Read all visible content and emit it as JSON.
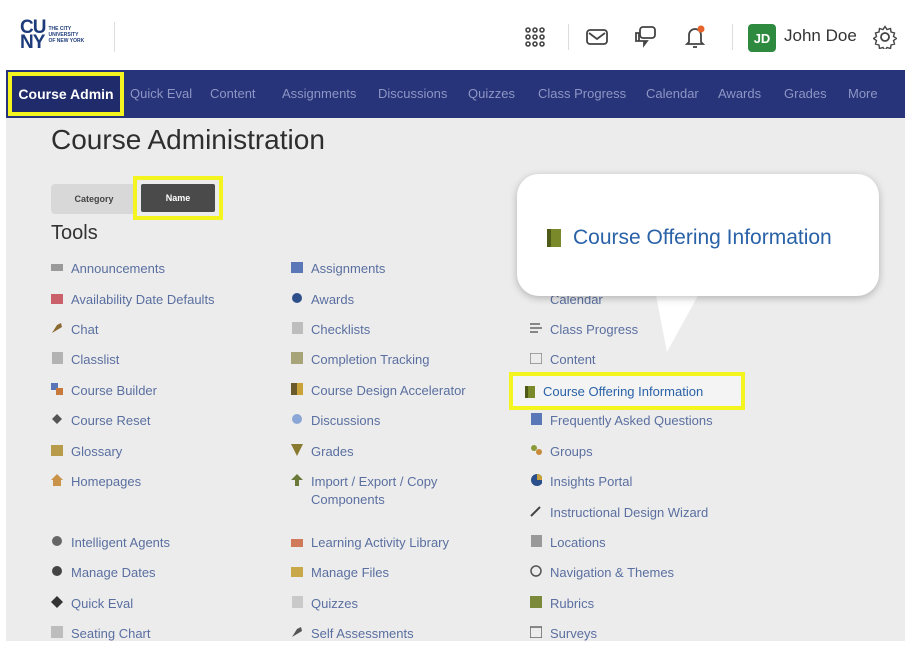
{
  "header": {
    "logo_mark": "CU\nNY",
    "logo_text": "THE CITY UNIVERSITY OF NEW YORK",
    "user_initials": "JD",
    "user_name": "John Doe"
  },
  "navbar": {
    "active": "Course Admin",
    "items": [
      "Quick Eval",
      "Content",
      "Assignments",
      "Discussions",
      "Quizzes",
      "Class Progress",
      "Calendar",
      "Awards",
      "Grades",
      "More"
    ]
  },
  "main": {
    "title": "Course Administration",
    "view_toggle": {
      "category": "Category",
      "name": "Name"
    },
    "tools_heading": "Tools",
    "col1": [
      "Announcements",
      "Availability Date Defaults",
      "Chat",
      "Classlist",
      "Course Builder",
      "Course Reset",
      "Glossary",
      "Homepages",
      "Intelligent Agents",
      "Manage Dates",
      "Quick Eval",
      "Seating Chart"
    ],
    "col2": [
      "Assignments",
      "Awards",
      "Checklists",
      "Completion Tracking",
      "Course Design Accelerator",
      "Discussions",
      "Grades",
      "Import / Export / Copy Components",
      "Learning Activity Library",
      "Manage Files",
      "Quizzes",
      "Self Assessments"
    ],
    "col3": [
      "Calendar",
      "Class Progress",
      "Content",
      "Course Offering Information",
      "Frequently Asked Questions",
      "Groups",
      "Insights Portal",
      "Instructional Design Wizard",
      "Locations",
      "Navigation & Themes",
      "Rubrics",
      "Surveys"
    ]
  },
  "callout": {
    "text": "Course Offering Information"
  },
  "colors": {
    "nav_bg": "#27347a",
    "highlight": "#f4f41e",
    "link": "#2a62a8",
    "avatar": "#2d8a3e"
  }
}
